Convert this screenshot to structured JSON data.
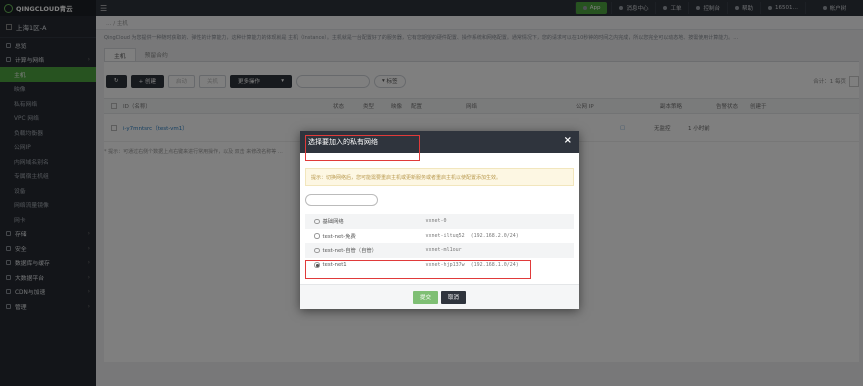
{
  "brand": "QINGCLOUD青云",
  "zone": "上海1区-A",
  "topbar": {
    "app": "App",
    "messages": "消息中心",
    "tickets": "工单",
    "console": "控制台",
    "help": "帮助",
    "user": "16501…",
    "account": "帐户树"
  },
  "sidebar": {
    "items": [
      {
        "label": "总览",
        "type": "group"
      },
      {
        "label": "计算与网络",
        "type": "group"
      },
      {
        "label": "主机",
        "type": "sub",
        "active": true
      },
      {
        "label": "映像",
        "type": "sub"
      },
      {
        "label": "私有网络",
        "type": "sub"
      },
      {
        "label": "VPC 网络",
        "type": "sub"
      },
      {
        "label": "负载均衡器",
        "type": "sub"
      },
      {
        "label": "公网IP",
        "type": "sub"
      },
      {
        "label": "内网域名别名",
        "type": "sub"
      },
      {
        "label": "专属宿主机组",
        "type": "sub"
      },
      {
        "label": "设备",
        "type": "sub"
      },
      {
        "label": "网络流量镜像",
        "type": "sub"
      },
      {
        "label": "网卡",
        "type": "sub"
      },
      {
        "label": "存储",
        "type": "group"
      },
      {
        "label": "安全",
        "type": "group"
      },
      {
        "label": "数据库与缓存",
        "type": "group"
      },
      {
        "label": "大数据平台",
        "type": "group"
      },
      {
        "label": "CDN与加速",
        "type": "group"
      },
      {
        "label": "管理",
        "type": "group"
      }
    ]
  },
  "breadcrumb": "… / 主机",
  "page": {
    "description": "QingCloud 为您提供一种随时获取的、弹性的计算能力，这种计算能力的体现就是 主机（Instance）。主机就是一台配置好了的服务器，它有您期望的硬件配置、操作系统和网络配置。通常情况下，您的请求可以在10秒钟的时间之内完成，所以您完全可以动态地、按需使用计算能力。…",
    "tabs": [
      "主机",
      "预留合约"
    ],
    "toolbar": {
      "create": "+ 创建",
      "start": "启动",
      "stop": "关机",
      "more": "更多操作",
      "tag": "标签",
      "pager": "合计：1  每页"
    },
    "table": {
      "headers": [
        "ID（名称）",
        "状态",
        "类型",
        "映像",
        "配置",
        "网络",
        "公网 IP",
        "副本策略",
        "告警状态",
        "创建于"
      ],
      "row": {
        "id": "i-y7mntsrc（test-vm1）",
        "alarm": "无监控",
        "created": "1 小时前"
      }
    },
    "note": "* 提示：可通过右侧个数据上点右键来进行常用操作，以及 双击 来修改名称等 …"
  },
  "modal": {
    "title": "选择要加入的私有网络",
    "close": "×",
    "tip": "提示：切换网络后，您可能需要重启主机或更新服务或者重启主机以使配置添加生效。",
    "networks": [
      {
        "name": "基础网络",
        "id": "vxnet-0",
        "cidr": "",
        "checked": false
      },
      {
        "name": "test-net-免费",
        "id": "vxnet-iltuq52",
        "cidr": "(192.168.2.0/24)",
        "checked": false
      },
      {
        "name": "test-net-自管（自管）",
        "id": "vxnet-ml1our",
        "cidr": "",
        "checked": false
      },
      {
        "name": "test-net1",
        "id": "vxnet-hjp137w",
        "cidr": "(192.168.1.0/24)",
        "checked": true
      }
    ],
    "submit": "提交",
    "cancel": "取消"
  },
  "colors": {
    "accent": "#4fa640",
    "topbar": "#2f343d",
    "highlight": "#e03a3a"
  }
}
